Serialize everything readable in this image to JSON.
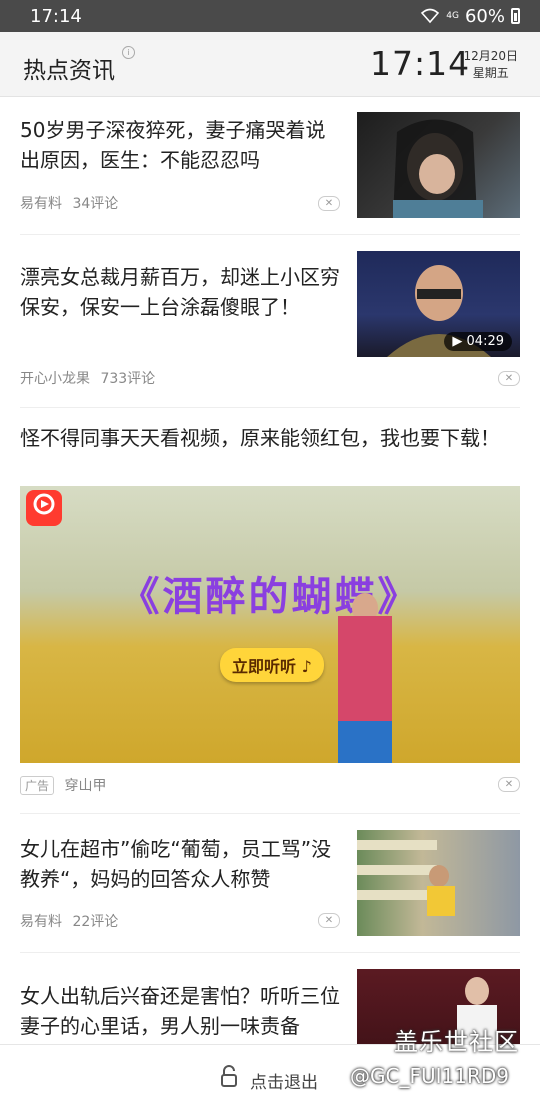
{
  "status": {
    "time": "17:14",
    "network": "4G",
    "battery": "60%"
  },
  "header": {
    "title": "热点资讯",
    "time": "17:14",
    "date": "12月20日",
    "weekday": "星期五"
  },
  "news": [
    {
      "title": "50岁男子深夜猝死，妻子痛哭着说出原因，医生：不能忍忍吗",
      "source": "易有料",
      "comments": "34评论"
    },
    {
      "title": "漂亮女总裁月薪百万，却迷上小区穷保安，保安一上台涂磊傻眼了！",
      "source": "开心小龙果",
      "comments": "733评论",
      "duration": "04:29"
    },
    {
      "title": "女儿在超市”偷吃“葡萄，员工骂”没教养“，妈妈的回答众人称赞",
      "source": "易有料",
      "comments": "22评论"
    },
    {
      "title": "女人出轨后兴奋还是害怕？听听三位妻子的心里话，男人别一味责备"
    }
  ],
  "ad": {
    "title": "怪不得同事天天看视频，原来能领红包，我也要下载！",
    "headline": "《酒醉的蝴蝶》",
    "button": "立即听听",
    "tag": "广告",
    "source": "穿山甲"
  },
  "bottom": {
    "exit_label": "点击退出"
  },
  "watermark": {
    "site": "盖乐世社区",
    "user": "@GC_FUI11RD9"
  },
  "icons": {
    "close": "close-icon",
    "lock": "lock-icon",
    "play": "play-icon"
  }
}
